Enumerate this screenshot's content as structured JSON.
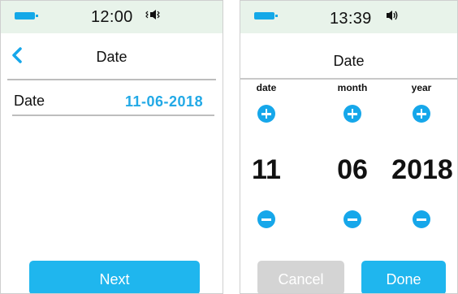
{
  "screens": [
    {
      "status": {
        "time": "12:00",
        "battery_icon": "battery-full-icon",
        "sound_icon": "speaker-muted-icon"
      },
      "header": {
        "title": "Date",
        "back_icon": "chevron-left-icon"
      },
      "row": {
        "label": "Date",
        "value": "11-06-2018"
      },
      "next_label": "Next"
    },
    {
      "status": {
        "time": "13:39",
        "battery_icon": "battery-full-icon",
        "sound_icon": "speaker-on-icon"
      },
      "header": {
        "title": "Date"
      },
      "columns": [
        {
          "label": "date",
          "value": "11"
        },
        {
          "label": "month",
          "value": "06"
        },
        {
          "label": "year",
          "value": "2018"
        }
      ],
      "cancel_label": "Cancel",
      "done_label": "Done"
    }
  ],
  "colors": {
    "accent": "#1fb6ee",
    "status_bg": "#e8f3ea",
    "disabled": "#d4d4d4",
    "value_text": "#22a9e6"
  }
}
